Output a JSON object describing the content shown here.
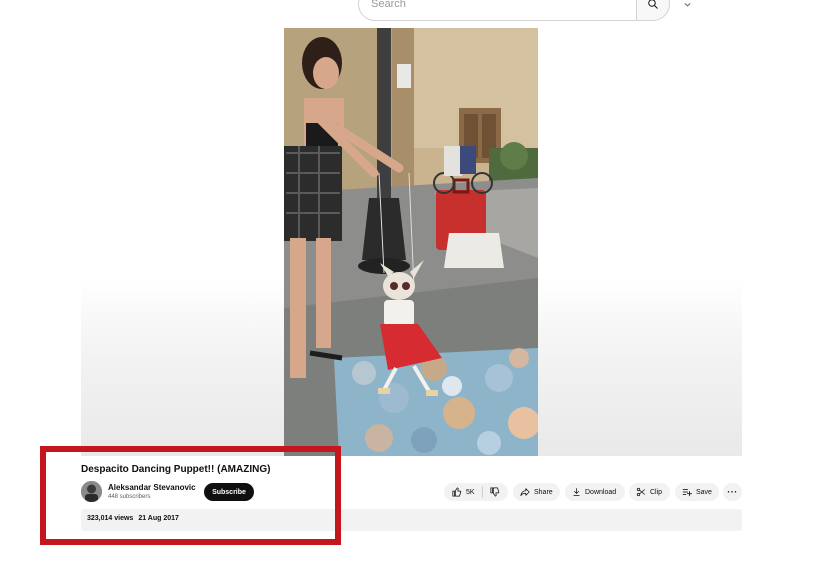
{
  "search": {
    "placeholder": "Search"
  },
  "video": {
    "title": "Despacito Dancing Puppet!! (AMAZING)",
    "views": "323,014 views",
    "date": "21 Aug 2017"
  },
  "channel": {
    "name": "Aleksandar Stevanovic",
    "subscribers": "448 subscribers",
    "subscribe_label": "Subscribe"
  },
  "actions": {
    "like_count": "5K",
    "share_label": "Share",
    "download_label": "Download",
    "clip_label": "Clip",
    "save_label": "Save",
    "more_label": "···"
  },
  "icons": {
    "search": "search-icon",
    "dropdown": "chevron-down-icon",
    "like": "thumbs-up-icon",
    "dislike": "thumbs-down-icon",
    "share": "share-arrow-icon",
    "download": "download-icon",
    "clip": "scissors-icon",
    "save": "playlist-add-icon"
  },
  "colors": {
    "highlight": "#c4161c",
    "subscribe_bg": "#0f0f0f",
    "pill_bg": "#f2f2f2"
  }
}
